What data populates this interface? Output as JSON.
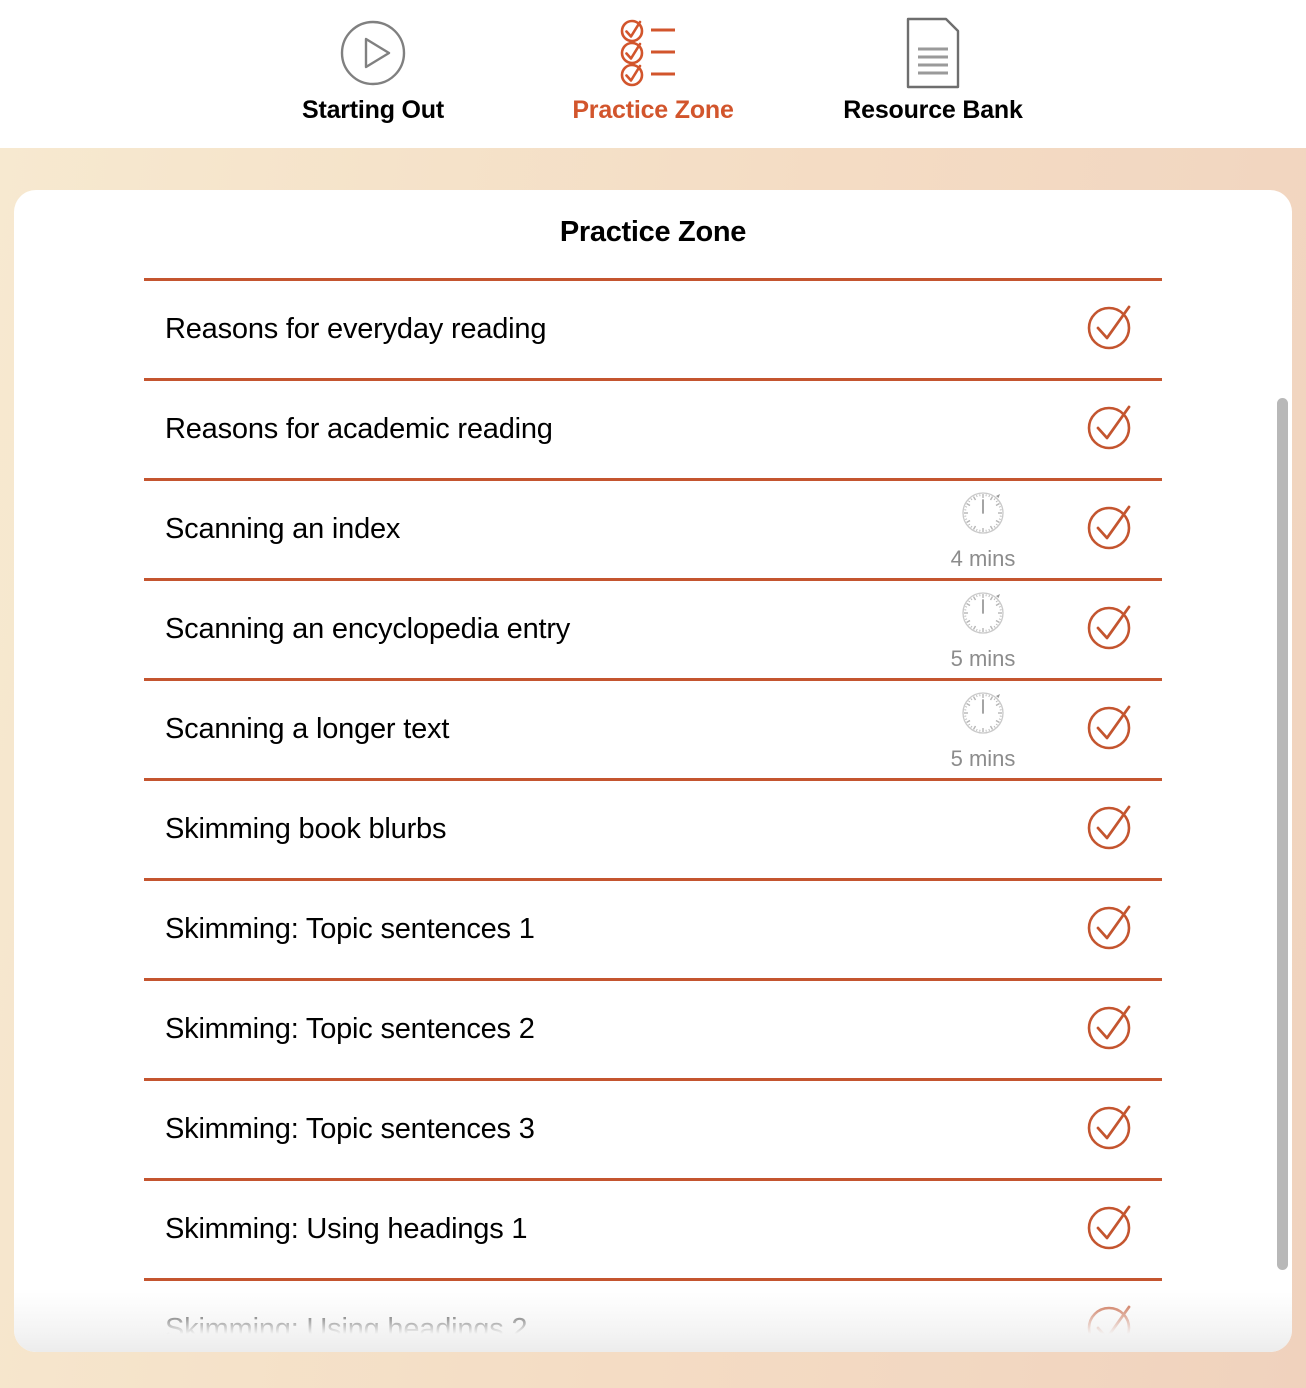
{
  "tabs": [
    {
      "label": "Starting Out",
      "icon": "play-circle-icon",
      "active": false
    },
    {
      "label": "Practice Zone",
      "icon": "checklist-icon",
      "active": true
    },
    {
      "label": "Resource Bank",
      "icon": "document-icon",
      "active": false
    }
  ],
  "card": {
    "title": "Practice Zone"
  },
  "colors": {
    "accent": "#d2552c",
    "divider": "#c4552f",
    "check": "#c4552f",
    "timer_text": "#8c8c8c",
    "text": "#000000",
    "card_bg": "#ffffff",
    "page_bg_left": "#f7e9d0",
    "page_bg_right": "#f0d2bd",
    "scrollbar": "#b8b8b8"
  },
  "list": [
    {
      "label": "Reasons for everyday reading",
      "duration": "",
      "check": "check-circle-icon"
    },
    {
      "label": "Reasons for academic reading",
      "duration": "",
      "check": "check-circle-icon"
    },
    {
      "label": "Scanning an index",
      "duration": "4 mins",
      "check": "check-circle-icon"
    },
    {
      "label": "Scanning an encyclopedia entry",
      "duration": "5 mins",
      "check": "check-circle-icon"
    },
    {
      "label": "Scanning a longer text",
      "duration": "5 mins",
      "check": "check-circle-icon"
    },
    {
      "label": "Skimming book blurbs",
      "duration": "",
      "check": "check-circle-icon"
    },
    {
      "label": "Skimming: Topic sentences 1",
      "duration": "",
      "check": "check-circle-icon"
    },
    {
      "label": "Skimming: Topic sentences 2",
      "duration": "",
      "check": "check-circle-icon"
    },
    {
      "label": "Skimming: Topic sentences 3",
      "duration": "",
      "check": "check-circle-icon"
    },
    {
      "label": "Skimming: Using headings 1",
      "duration": "",
      "check": "check-circle-icon"
    },
    {
      "label": "Skimming: Using headings 2",
      "duration": "",
      "check": "check-circle-icon"
    }
  ]
}
